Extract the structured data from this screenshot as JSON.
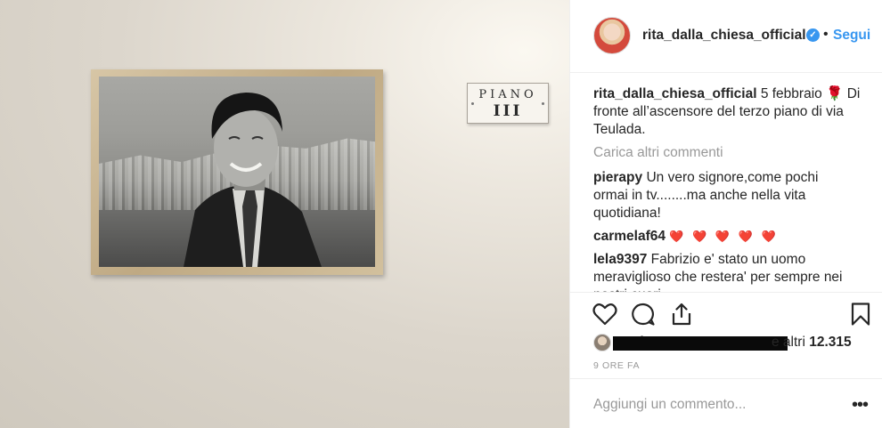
{
  "photo": {
    "sign_line1": "PIANO",
    "sign_line2": "III"
  },
  "header": {
    "username": "rita_dalla_chiesa_official",
    "verified_mark": "✓",
    "separator": "•",
    "follow_label": "Segui"
  },
  "caption": {
    "username": "rita_dalla_chiesa_official",
    "date": "5 febbraio",
    "emoji": "🌹",
    "text": "Di fronte all’ascensore del terzo piano di via Teulada."
  },
  "load_more": "Carica altri commenti",
  "comments": [
    {
      "username": "pierapy",
      "text": "Un vero signore,come pochi ormai in tv........ma anche nella vita quotidiana!"
    },
    {
      "username": "carmelaf64",
      "text": "❤️ ❤️ ❤️ ❤️ ❤️"
    },
    {
      "username": "lela9397",
      "text": "Fabrizio e' stato un uomo meraviglioso che restera' per sempre nei nostri cuori"
    }
  ],
  "actions": {
    "like_icon": "heart-outline",
    "comment_icon": "speech-bubble",
    "share_icon": "share-upload",
    "save_icon": "bookmark"
  },
  "likes": {
    "prefix": "Pi",
    "and_others": "e altri",
    "count": "12.315"
  },
  "timestamp": "9 ORE FA",
  "add_comment_placeholder": "Aggiungi un commento...",
  "more_label": "•••",
  "colors": {
    "link_blue": "#3897f0",
    "muted_gray": "#999999",
    "heart_red": "#e32424"
  }
}
